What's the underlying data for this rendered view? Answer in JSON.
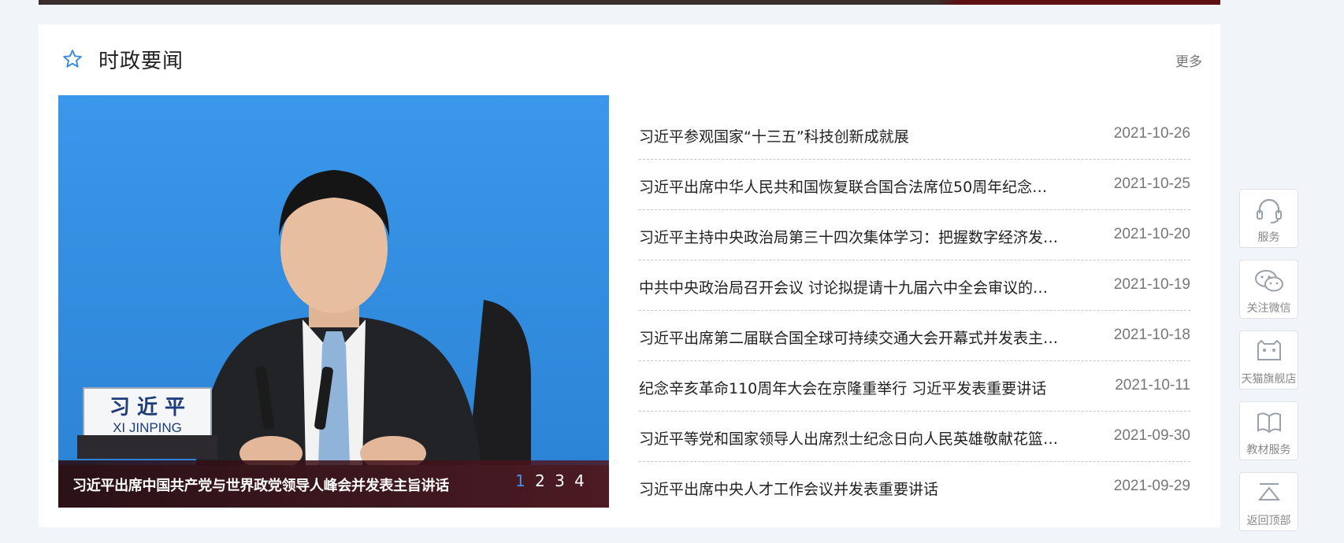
{
  "section": {
    "title": "时政要闻",
    "more": "更多"
  },
  "carousel": {
    "caption": "习近平出席中国共产党与世界政党领导人峰会并发表主旨讲话",
    "name_plate": {
      "cn": "习 近 平",
      "en": "XI JINPING"
    },
    "pages": [
      "1",
      "2",
      "3",
      "4"
    ],
    "active_page": 1
  },
  "news": [
    {
      "title": "习近平参观国家“十三五”科技创新成就展",
      "date": "2021-10-26"
    },
    {
      "title": "习近平出席中华人民共和国恢复联合国合法席位50周年纪念…",
      "date": "2021-10-25"
    },
    {
      "title": "习近平主持中央政治局第三十四次集体学习：把握数字经济发…",
      "date": "2021-10-20"
    },
    {
      "title": "中共中央政治局召开会议 讨论拟提请十九届六中全会审议的…",
      "date": "2021-10-19"
    },
    {
      "title": "习近平出席第二届联合国全球可持续交通大会开幕式并发表主…",
      "date": "2021-10-18"
    },
    {
      "title": "纪念辛亥革命110周年大会在京隆重举行 习近平发表重要讲话",
      "date": "2021-10-11"
    },
    {
      "title": "习近平等党和国家领导人出席烈士纪念日向人民英雄敬献花篮…",
      "date": "2021-09-30"
    },
    {
      "title": "习近平出席中央人才工作会议并发表重要讲话",
      "date": "2021-09-29"
    }
  ],
  "side_tools": [
    {
      "label": "服务",
      "icon": "headset-icon"
    },
    {
      "label": "关注微信",
      "icon": "wechat-icon"
    },
    {
      "label": "天猫旗舰店",
      "icon": "tmall-icon",
      "icon_text": "天猫 TMALL.COM"
    },
    {
      "label": "教材服务",
      "icon": "book-icon"
    },
    {
      "label": "返回顶部",
      "icon": "back-to-top-icon"
    }
  ],
  "colors": {
    "background": "#f1f4f8",
    "accent_blue": "#4a90e2",
    "caption_bg": "#4a1420"
  }
}
